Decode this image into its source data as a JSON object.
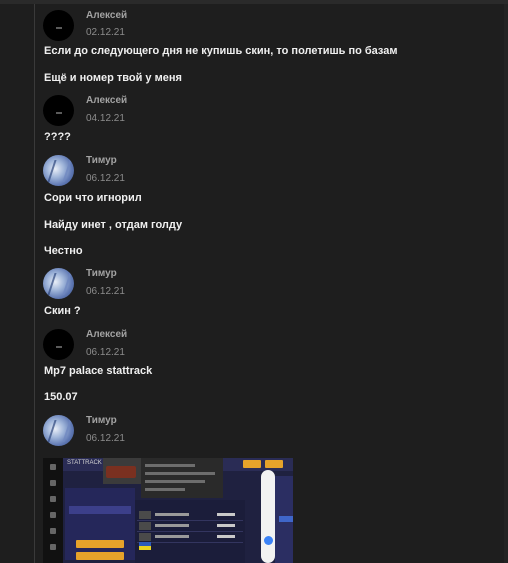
{
  "messages": [
    {
      "author": "Алексей",
      "date": "02.12.21",
      "avatar": "dark-avatar",
      "lines": [
        "Если до следующего дня не купишь скин, то полетишь по базам",
        "Ещё и номер твой у меня"
      ]
    },
    {
      "author": "Алексей",
      "date": "04.12.21",
      "avatar": "dark-avatar",
      "lines": [
        "????"
      ]
    },
    {
      "author": "Тимур",
      "date": "06.12.21",
      "avatar": "blue-avatar",
      "lines": [
        "Сори что игнорил",
        "Найду инет , отдам голду",
        "Честно"
      ]
    },
    {
      "author": "Тимур",
      "date": "06.12.21",
      "avatar": "blue-avatar",
      "lines": [
        "Скин ?"
      ]
    },
    {
      "author": "Алексей",
      "date": "06.12.21",
      "avatar": "dark-avatar",
      "lines": [
        "Mp7 palace stattrack",
        "150.07"
      ]
    },
    {
      "author": "Тимур",
      "date": "06.12.21",
      "avatar": "blue-avatar",
      "lines": []
    }
  ],
  "attachment": {
    "type": "screenshot-image",
    "header_text": "STATTRACK",
    "colors": {
      "accent": "#e6a32a",
      "background": "#1f2140",
      "knob": "#3b82f6"
    }
  },
  "colors": {
    "app_background": "#1e1e1e",
    "author": "#a3a3a3",
    "date": "#8c8c8c",
    "text": "#f0f0f0"
  }
}
